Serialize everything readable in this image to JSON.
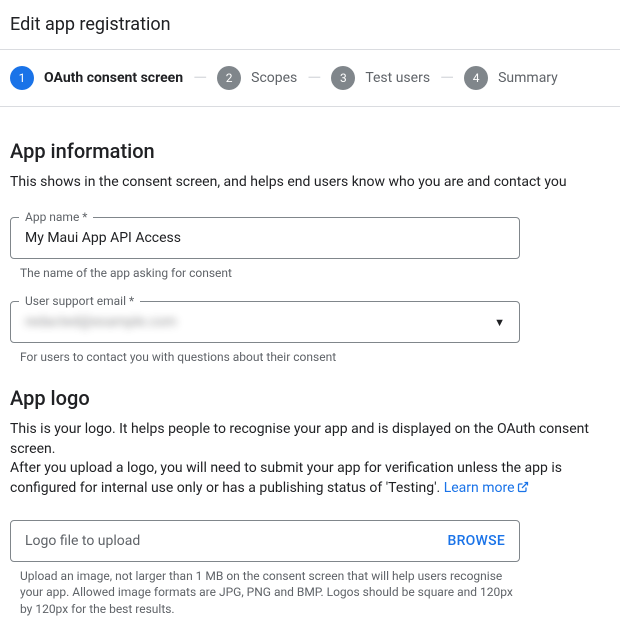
{
  "header": {
    "title": "Edit app registration"
  },
  "stepper": {
    "steps": [
      {
        "num": "1",
        "label": "OAuth consent screen"
      },
      {
        "num": "2",
        "label": "Scopes"
      },
      {
        "num": "3",
        "label": "Test users"
      },
      {
        "num": "4",
        "label": "Summary"
      }
    ]
  },
  "appInfo": {
    "title": "App information",
    "desc": "This shows in the consent screen, and helps end users know who you are and contact you",
    "appName": {
      "label": "App name *",
      "value": "My Maui App API Access",
      "helper": "The name of the app asking for consent"
    },
    "supportEmail": {
      "label": "User support email *",
      "value": "redacted@example.com",
      "helper": "For users to contact you with questions about their consent"
    }
  },
  "appLogo": {
    "title": "App logo",
    "desc1": "This is your logo. It helps people to recognise your app and is displayed on the OAuth consent screen.",
    "desc2a": "After you upload a logo, you will need to submit your app for verification unless the app is configured for internal use only or has a publishing status of 'Testing'. ",
    "learnMore": "Learn more",
    "upload": {
      "placeholder": "Logo file to upload",
      "browse": "BROWSE",
      "helper": "Upload an image, not larger than 1 MB on the consent screen that will help users recognise your app. Allowed image formats are JPG, PNG and BMP. Logos should be square and 120px by 120px for the best results."
    }
  }
}
